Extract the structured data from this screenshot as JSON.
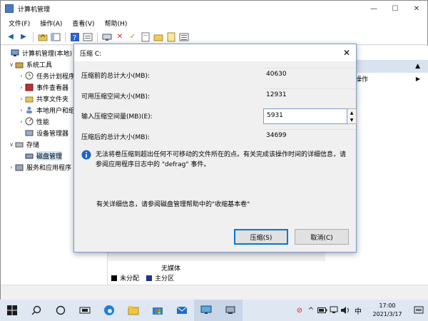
{
  "window": {
    "title": "计算机管理",
    "minimize": "—",
    "maximize": "☐",
    "close": "✕"
  },
  "menu": [
    "文件(F)",
    "操作(A)",
    "查看(V)",
    "帮助(H)"
  ],
  "tree": [
    {
      "label": "计算机管理(本地)",
      "expander": "",
      "indent": 0,
      "icon": "computer-icon"
    },
    {
      "label": "系统工具",
      "expander": "∨",
      "indent": 1,
      "icon": "tools-icon"
    },
    {
      "label": "任务计划程序",
      "expander": "›",
      "indent": 2,
      "icon": "clock-icon"
    },
    {
      "label": "事件查看器",
      "expander": "›",
      "indent": 2,
      "icon": "event-viewer-icon"
    },
    {
      "label": "共享文件夹",
      "expander": "›",
      "indent": 2,
      "icon": "shared-folder-icon"
    },
    {
      "label": "本地用户和组",
      "expander": "›",
      "indent": 2,
      "icon": "users-icon"
    },
    {
      "label": "性能",
      "expander": "›",
      "indent": 2,
      "icon": "performance-icon"
    },
    {
      "label": "设备管理器",
      "expander": "",
      "indent": 2,
      "icon": "device-manager-icon"
    },
    {
      "label": "存储",
      "expander": "∨",
      "indent": 1,
      "icon": "storage-icon"
    },
    {
      "label": "磁盘管理",
      "expander": "",
      "indent": 2,
      "icon": "disk-icon",
      "selected": true
    },
    {
      "label": "服务和应用程序",
      "expander": "›",
      "indent": 1,
      "icon": "services-icon"
    }
  ],
  "actions": {
    "head_arrow": "▲",
    "item": "操作",
    "item_arrow": "▶"
  },
  "disk": {
    "no_media": "无媒体",
    "legend_unallocated": "未分配",
    "legend_primary": "主分区"
  },
  "dialog": {
    "title": "压缩 C:",
    "close": "✕",
    "total_before_label": "压缩前的总计大小(MB):",
    "total_before_value": "40630",
    "available_label": "可用压缩空间大小(MB):",
    "available_value": "12931",
    "input_label": "输入压缩空间量(MB)(E):",
    "input_value": "5931",
    "total_after_label": "压缩后的总计大小(MB):",
    "total_after_value": "34699",
    "info_text": "无法将卷压缩到超出任何不可移动的文件所在的点。有关完成该操作时间的详细信息，请参阅应用程序日志中的 \"defrag\" 事件。",
    "help_text": "有关详细信息，请参阅磁盘管理帮助中的\"收缩基本卷\"",
    "shrink_button": "压缩(S)",
    "cancel_button": "取消(C)"
  },
  "taskbar": {
    "ime": "中",
    "time": "17:00",
    "date": "2021/3/17"
  },
  "colors": {
    "accent": "#0078d7",
    "unallocated": "#000000",
    "primary_partition": "#1f2f9e"
  }
}
